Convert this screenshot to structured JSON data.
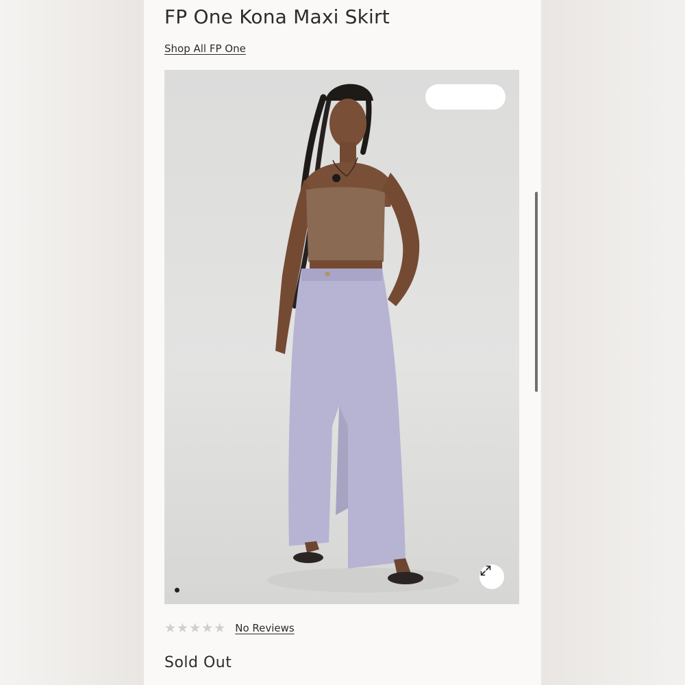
{
  "product": {
    "title": "FP One Kona Maxi Skirt",
    "shop_link": "Shop All FP One",
    "reviews_label": "No Reviews",
    "rating": 0,
    "rating_max": 5,
    "status": "Sold Out"
  },
  "gallery": {
    "image_alt": "model wearing lavender denim maxi skirt with brown tube top",
    "current_slide": 1,
    "expand_icon": "expand-icon"
  },
  "colors": {
    "skirt": "#b6b3d3",
    "top": "#8a6a52",
    "background": "#dcdcdb",
    "star_empty": "#cfcfcf"
  }
}
